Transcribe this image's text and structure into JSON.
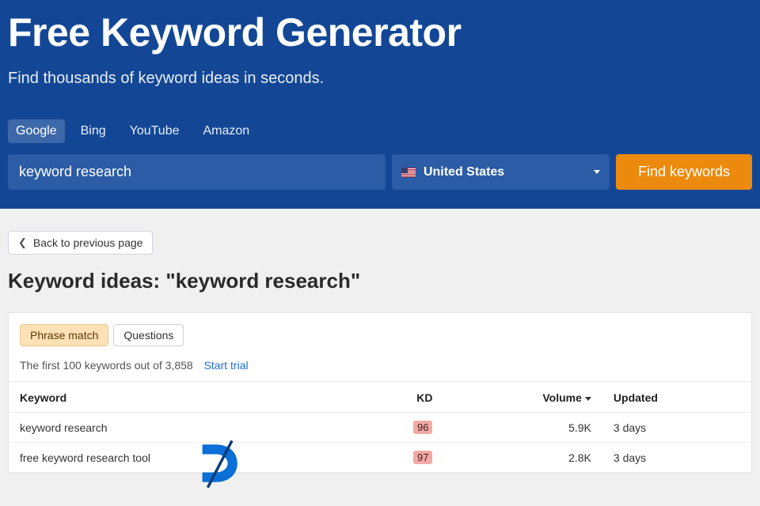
{
  "hero": {
    "title": "Free Keyword Generator",
    "subtitle": "Find thousands of keyword ideas in seconds."
  },
  "engines": {
    "items": [
      "Google",
      "Bing",
      "YouTube",
      "Amazon"
    ],
    "active_index": 0
  },
  "search": {
    "value": "keyword research",
    "country": "United States",
    "button": "Find keywords"
  },
  "back": {
    "label": "Back to previous page"
  },
  "results": {
    "heading": "Keyword ideas: \"keyword research\"",
    "tabs": {
      "items": [
        "Phrase match",
        "Questions"
      ],
      "active_index": 0
    },
    "info_text": "The first 100 keywords out of 3,858",
    "trial_link": "Start trial",
    "columns": {
      "keyword": "Keyword",
      "kd": "KD",
      "volume": "Volume",
      "updated": "Updated"
    },
    "rows": [
      {
        "keyword": "keyword research",
        "kd": "96",
        "volume": "5.9K",
        "updated": "3 days"
      },
      {
        "keyword": "free keyword research tool",
        "kd": "97",
        "volume": "2.8K",
        "updated": "3 days"
      }
    ]
  }
}
